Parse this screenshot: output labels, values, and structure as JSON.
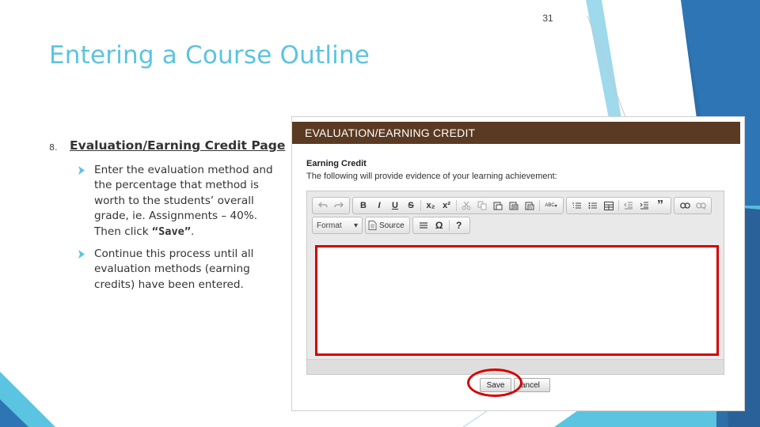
{
  "slide": {
    "number": "31",
    "title": "Entering a Course Outline",
    "step_number": "8.",
    "step_title": "Evaluation/Earning Credit Page",
    "bullets": [
      {
        "text_before": "Enter the evaluation method and the percentage that method is worth to the students’ overall grade, ie. Assignments – 40%. Then click ",
        "strong": "“Save”",
        "text_after": "."
      },
      {
        "text": "Continue this process until all evaluation methods (earning credits) have been entered."
      }
    ]
  },
  "colors": {
    "title": "#5BC4E0",
    "header_bar": "#5a3a22",
    "highlight": "#d40000",
    "deco_blue_dark": "#2E75B6",
    "deco_blue_light": "#5BC4E0"
  },
  "screenshot": {
    "header": "EVALUATION/EARNING CREDIT",
    "field_label": "Earning Credit",
    "field_description": "The following will provide evidence of your learning achievement:",
    "toolbar": {
      "row1": [
        [
          "undo-icon",
          "redo-icon"
        ],
        [
          "bold",
          "italic",
          "underline",
          "strikethrough",
          "subscript",
          "superscript",
          "cut-icon",
          "copy-icon",
          "paste-icon",
          "paste-text-icon",
          "paste-word-icon",
          "spellcheck-icon"
        ],
        [
          "numbered-list-icon",
          "bulleted-list-icon",
          "table-icon",
          "outdent-icon",
          "indent-icon",
          "blockquote-icon"
        ],
        [
          "link-icon",
          "unlink-icon"
        ]
      ],
      "row2": {
        "format_label": "Format",
        "source_label": "Source",
        "others": [
          "horizontal-line-icon",
          "special-char-icon",
          "help-icon"
        ]
      },
      "glyphs": {
        "bold": "B",
        "italic": "I",
        "underline": "U",
        "strikethrough": "S",
        "subscript": "x₂",
        "superscript": "x²",
        "omega": "Ω",
        "help": "?",
        "spell": "ABC"
      }
    },
    "buttons": {
      "save": "Save",
      "cancel": "ancel"
    }
  }
}
